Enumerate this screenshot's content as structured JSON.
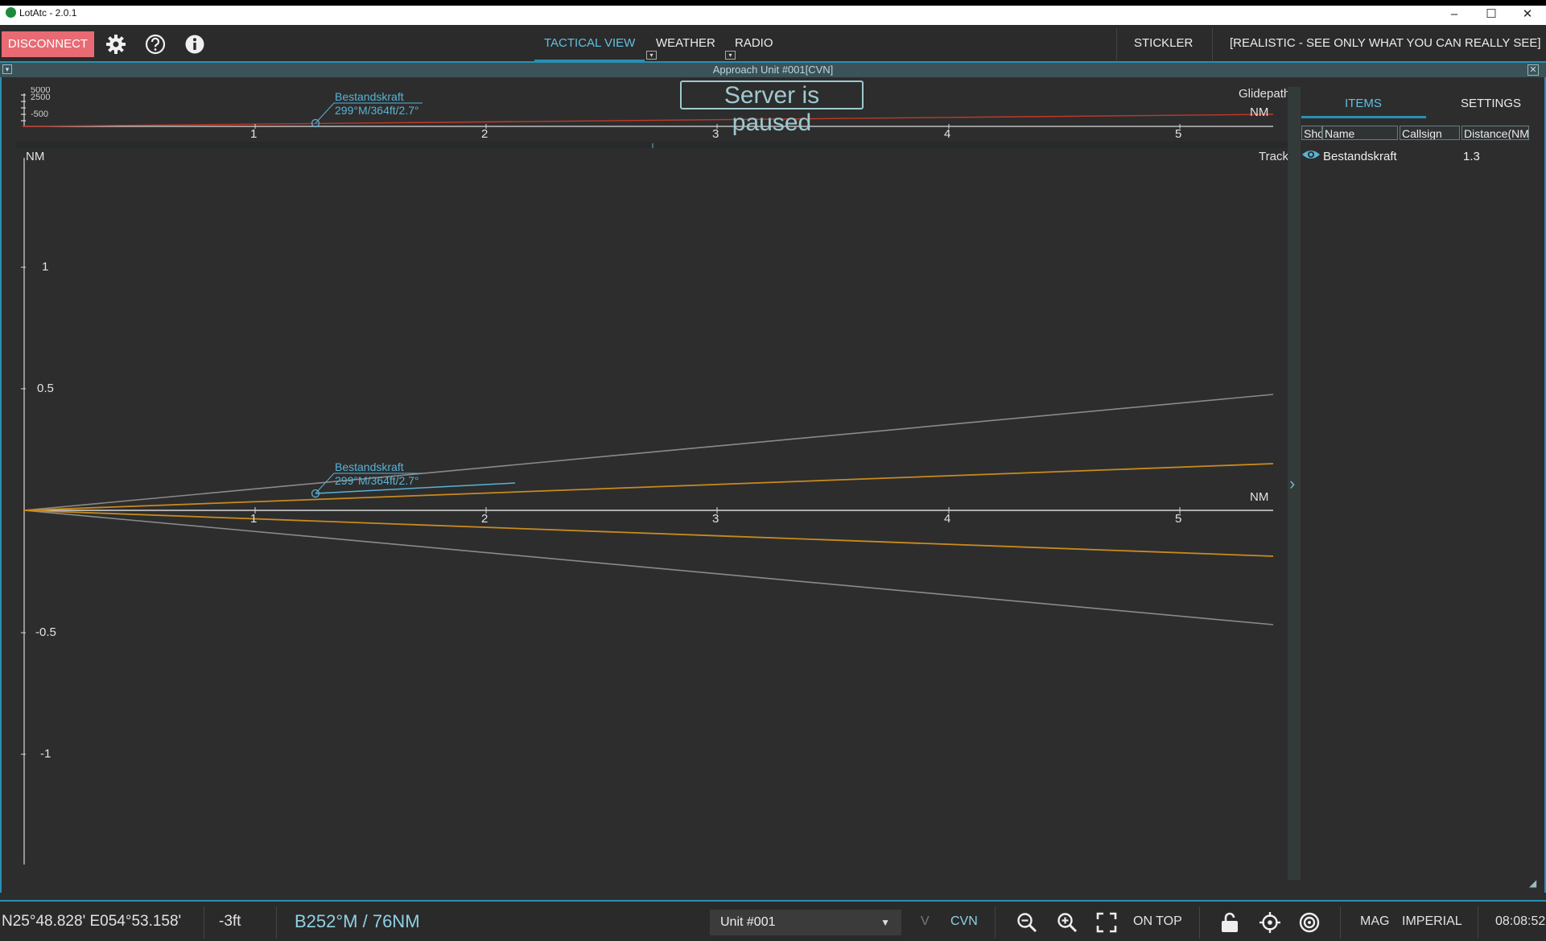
{
  "window": {
    "title": "LotAtc - 2.0.1",
    "minimize": "–",
    "maximize": "☐",
    "close": "✕"
  },
  "toolbar": {
    "disconnect_label": "DISCONNECT",
    "tabs": [
      {
        "label": "TACTICAL VIEW",
        "active": true
      },
      {
        "label": "WEATHER",
        "active": false
      },
      {
        "label": "RADIO",
        "active": false
      }
    ],
    "stickler_label": "STICKLER",
    "mode_label": "[REALISTIC - SEE ONLY WHAT YOU CAN REALLY SEE]"
  },
  "panel": {
    "title": "Approach Unit #001[CVN]"
  },
  "overlay": {
    "paused": "Server is paused"
  },
  "glidepath": {
    "title": "Glidepath",
    "unit": "NM",
    "x_ticks": [
      "1",
      "2",
      "3",
      "4",
      "5"
    ],
    "altitude_labels": [
      "5000",
      "2500",
      "-500"
    ],
    "target": {
      "name": "Bestandskraft",
      "info": "299°M/364ft/2.7°"
    }
  },
  "track": {
    "title": "Track",
    "y_unit": "NM",
    "x_unit": "NM",
    "x_ticks": [
      "1",
      "2",
      "3",
      "4",
      "5"
    ],
    "y_ticks": [
      "1",
      "0.5",
      "-0.5",
      "-1"
    ],
    "target": {
      "name": "Bestandskraft",
      "info": "299°M/364ft/2.7°"
    }
  },
  "side": {
    "tabs": [
      {
        "label": "ITEMS",
        "active": true
      },
      {
        "label": "SETTINGS",
        "active": false
      }
    ],
    "columns": [
      "Sho",
      "Name",
      "Callsign",
      "Distance(NM"
    ],
    "rows": [
      {
        "show": true,
        "name": "Bestandskraft",
        "callsign": "",
        "distance": "1.3"
      }
    ]
  },
  "status": {
    "coords": "N25°48.828' E054°53.158'",
    "altitude": "-3ft",
    "bearing": "B252°M / 76NM",
    "unit_selected": "Unit #001",
    "v_label": "V",
    "cvn_label": "CVN",
    "on_top_label": "ON TOP",
    "mag_label": "MAG",
    "imperial_label": "IMPERIAL",
    "time": "08:08:52"
  },
  "colors": {
    "accent": "#2a8fb3",
    "disconnect": "#e86a73",
    "target": "#58b3d6",
    "glidepath_line": "#c0392b",
    "course_inner": "#c98a1e",
    "course_outer": "#8a8a8a"
  },
  "icons": [
    "gear-icon",
    "help-icon",
    "info-icon",
    "zoom-out-icon",
    "zoom-in-icon",
    "fullscreen-icon",
    "lock-icon",
    "crosshair-icon",
    "target-icon",
    "eye-icon",
    "chevron-right-icon"
  ]
}
